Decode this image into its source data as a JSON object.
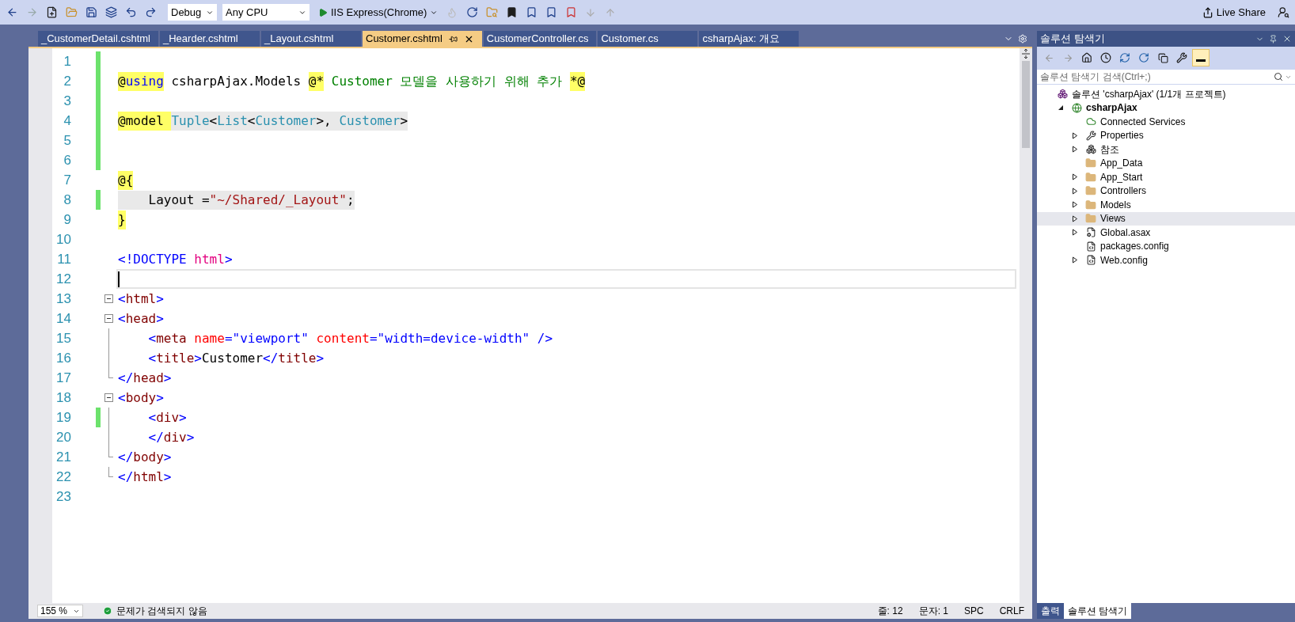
{
  "toolbar": {
    "configuration": "Debug",
    "platform": "Any CPU",
    "run_target": "IIS Express(Chrome)",
    "live_share": "Live Share"
  },
  "editor_tabs": [
    {
      "label": "_CustomerDetail.cshtml",
      "selected": false
    },
    {
      "label": "_Hearder.cshtml",
      "selected": false
    },
    {
      "label": "_Layout.cshtml",
      "selected": false
    },
    {
      "label": "Customer.cshtml",
      "selected": true
    },
    {
      "label": "CustomerController.cs",
      "selected": false
    },
    {
      "label": "Customer.cs",
      "selected": false
    },
    {
      "label": "csharpAjax: 개요",
      "selected": false
    }
  ],
  "code_lines": [
    {
      "number": "1",
      "changed": true,
      "current": false
    },
    {
      "number": "2",
      "changed": true,
      "current": false,
      "tokens": [
        {
          "text": "@",
          "kind": "razor"
        },
        {
          "text": "using",
          "kind": "razor-keyword"
        },
        {
          "text": " csharpAjax.Models ",
          "kind": "text"
        },
        {
          "text": "@*",
          "kind": "razor"
        },
        {
          "text": " Customer 모델을 사용하기 위해 추가 ",
          "kind": "comment"
        },
        {
          "text": "*@",
          "kind": "razor"
        }
      ]
    },
    {
      "number": "3",
      "changed": true,
      "current": false
    },
    {
      "number": "4",
      "changed": true,
      "current": false,
      "tokens": [
        {
          "text": "@model ",
          "kind": "razor"
        },
        {
          "text": "Tuple",
          "kind": "type"
        },
        {
          "text": "<",
          "kind": "code"
        },
        {
          "text": "List",
          "kind": "type"
        },
        {
          "text": "<",
          "kind": "code"
        },
        {
          "text": "Customer",
          "kind": "type"
        },
        {
          "text": ">, ",
          "kind": "code"
        },
        {
          "text": "Customer",
          "kind": "type"
        },
        {
          "text": ">",
          "kind": "code"
        }
      ]
    },
    {
      "number": "5",
      "changed": true,
      "current": false
    },
    {
      "number": "6",
      "changed": true,
      "current": false
    },
    {
      "number": "7",
      "changed": false,
      "current": false,
      "tokens": [
        {
          "text": "@{",
          "kind": "razor"
        }
      ]
    },
    {
      "number": "8",
      "changed": true,
      "current": false,
      "tokens": [
        {
          "text": "    Layout =",
          "kind": "code"
        },
        {
          "text": "\"~/Shared/_Layout\"",
          "kind": "string"
        },
        {
          "text": ";",
          "kind": "code"
        }
      ]
    },
    {
      "number": "9",
      "changed": false,
      "current": false,
      "tokens": [
        {
          "text": "}",
          "kind": "razor"
        }
      ]
    },
    {
      "number": "10",
      "changed": false,
      "current": false
    },
    {
      "number": "11",
      "changed": false,
      "current": false,
      "tokens": [
        {
          "text": "<!DOCTYPE",
          "kind": "bracket"
        },
        {
          "text": " html",
          "kind": "doctype"
        },
        {
          "text": ">",
          "kind": "bracket"
        }
      ]
    },
    {
      "number": "12",
      "changed": false,
      "current": true
    },
    {
      "number": "13",
      "changed": false,
      "current": false,
      "kind": "fold-start",
      "tokens": [
        {
          "text": "<",
          "kind": "bracket"
        },
        {
          "text": "html",
          "kind": "tag"
        },
        {
          "text": ">",
          "kind": "bracket"
        }
      ]
    },
    {
      "number": "14",
      "changed": false,
      "current": false,
      "kind": "fold-start",
      "tokens": [
        {
          "text": "<",
          "kind": "bracket"
        },
        {
          "text": "head",
          "kind": "tag"
        },
        {
          "text": ">",
          "kind": "bracket"
        }
      ]
    },
    {
      "number": "15",
      "changed": false,
      "current": false,
      "kind": "fold-inside",
      "tokens": [
        {
          "text": "    <",
          "kind": "bracket"
        },
        {
          "text": "meta",
          "kind": "tag"
        },
        {
          "text": " name",
          "kind": "attr"
        },
        {
          "text": "=",
          "kind": "bracket"
        },
        {
          "text": "\"viewport\"",
          "kind": "value"
        },
        {
          "text": " content",
          "kind": "attr"
        },
        {
          "text": "=",
          "kind": "bracket"
        },
        {
          "text": "\"width=device-width\"",
          "kind": "value"
        },
        {
          "text": " />",
          "kind": "bracket"
        }
      ]
    },
    {
      "number": "16",
      "changed": false,
      "current": false,
      "kind": "fold-inside",
      "tokens": [
        {
          "text": "    <",
          "kind": "bracket"
        },
        {
          "text": "title",
          "kind": "tag"
        },
        {
          "text": ">",
          "kind": "bracket"
        },
        {
          "text": "Customer",
          "kind": "text"
        },
        {
          "text": "</",
          "kind": "bracket"
        },
        {
          "text": "title",
          "kind": "tag"
        },
        {
          "text": ">",
          "kind": "bracket"
        }
      ]
    },
    {
      "number": "17",
      "changed": false,
      "current": false,
      "kind": "fold-end",
      "tokens": [
        {
          "text": "</",
          "kind": "bracket"
        },
        {
          "text": "head",
          "kind": "tag"
        },
        {
          "text": ">",
          "kind": "bracket"
        }
      ]
    },
    {
      "number": "18",
      "changed": false,
      "current": false,
      "kind": "fold-start",
      "tokens": [
        {
          "text": "<",
          "kind": "bracket"
        },
        {
          "text": "body",
          "kind": "tag"
        },
        {
          "text": ">",
          "kind": "bracket"
        }
      ]
    },
    {
      "number": "19",
      "changed": true,
      "current": false,
      "kind": "fold-inside",
      "tokens": [
        {
          "text": "    <",
          "kind": "bracket"
        },
        {
          "text": "div",
          "kind": "tag"
        },
        {
          "text": ">",
          "kind": "bracket"
        }
      ]
    },
    {
      "number": "20",
      "changed": false,
      "current": false,
      "kind": "fold-inside",
      "tokens": [
        {
          "text": "    </",
          "kind": "bracket"
        },
        {
          "text": "div",
          "kind": "tag"
        },
        {
          "text": ">",
          "kind": "bracket"
        }
      ]
    },
    {
      "number": "21",
      "changed": false,
      "current": false,
      "kind": "fold-end",
      "tokens": [
        {
          "text": "</",
          "kind": "bracket"
        },
        {
          "text": "body",
          "kind": "tag"
        },
        {
          "text": ">",
          "kind": "bracket"
        }
      ]
    },
    {
      "number": "22",
      "changed": false,
      "current": false,
      "kind": "fold-end",
      "tokens": [
        {
          "text": "</",
          "kind": "bracket"
        },
        {
          "text": "html",
          "kind": "tag"
        },
        {
          "text": ">",
          "kind": "bracket"
        }
      ]
    },
    {
      "number": "23",
      "changed": false,
      "current": false
    }
  ],
  "status_bar": {
    "zoom": "155 %",
    "issues": "문제가 검색되지 않음",
    "line": "줄: 12",
    "column": "문자: 1",
    "whitespace": "SPC",
    "line_ending": "CRLF"
  },
  "solution_explorer": {
    "title": "솔루션 탐색기",
    "search": {
      "placeholder": "솔루션 탐색기 검색(Ctrl+;)"
    },
    "tree": [
      {
        "label": "솔루션 'csharpAjax' (1/1개 프로젝트)",
        "kind": "solution",
        "selected": false,
        "children": [
          {
            "label": "csharpAjax",
            "kind": "project",
            "expanded": true,
            "selected": false,
            "children": [
              {
                "label": "Connected Services",
                "kind": "cloud",
                "selected": false
              },
              {
                "label": "Properties",
                "kind": "wrench",
                "expanded": false,
                "selected": false
              },
              {
                "label": "참조",
                "kind": "references",
                "expanded": false,
                "selected": false
              },
              {
                "label": "App_Data",
                "kind": "folder",
                "selected": false
              },
              {
                "label": "App_Start",
                "kind": "folder",
                "expanded": false,
                "selected": false
              },
              {
                "label": "Controllers",
                "kind": "folder",
                "expanded": false,
                "selected": false
              },
              {
                "label": "Models",
                "kind": "folder",
                "expanded": false,
                "selected": false
              },
              {
                "label": "Views",
                "kind": "folder",
                "expanded": false,
                "selected": true
              },
              {
                "label": "Global.asax",
                "kind": "gear-file",
                "expanded": false,
                "selected": false
              },
              {
                "label": "packages.config",
                "kind": "config",
                "selected": false
              },
              {
                "label": "Web.config",
                "kind": "config",
                "expanded": false,
                "selected": false
              }
            ]
          }
        ]
      }
    ],
    "bottom_tabs": [
      {
        "label": "출력",
        "selected": false
      },
      {
        "label": "솔루션 탐색기",
        "selected": true
      }
    ]
  }
}
